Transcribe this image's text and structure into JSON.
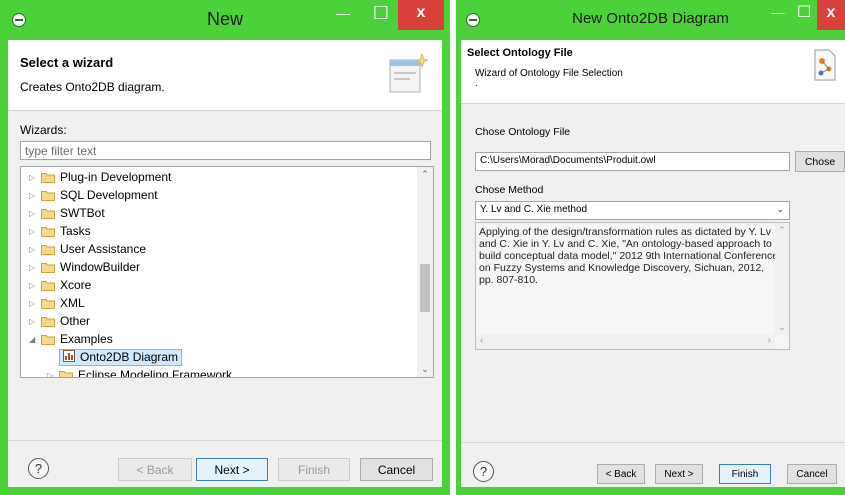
{
  "left_dialog": {
    "title": "New",
    "minimize": "—",
    "maximize": "☐",
    "close": "x",
    "header_title": "Select a wizard",
    "header_desc": "Creates Onto2DB diagram.",
    "wizards_label": "Wizards:",
    "filter_placeholder": "type filter text",
    "tree": [
      {
        "label": "Plug-in Development",
        "expanded": false
      },
      {
        "label": "SQL Development",
        "expanded": false
      },
      {
        "label": "SWTBot",
        "expanded": false
      },
      {
        "label": "Tasks",
        "expanded": false
      },
      {
        "label": "User Assistance",
        "expanded": false
      },
      {
        "label": "WindowBuilder",
        "expanded": false
      },
      {
        "label": "Xcore",
        "expanded": false
      },
      {
        "label": "XML",
        "expanded": false
      },
      {
        "label": "Other",
        "expanded": false
      },
      {
        "label": "Examples",
        "expanded": true
      },
      {
        "label": "Onto2DB Diagram",
        "selected": true
      },
      {
        "label": "Eclipse Modeling Framework",
        "expanded": false
      }
    ],
    "help": "?",
    "buttons": {
      "back": "< Back",
      "next": "Next >",
      "finish": "Finish",
      "cancel": "Cancel"
    }
  },
  "right_dialog": {
    "title": "New Onto2DB Diagram",
    "minimize": "—",
    "maximize": "☐",
    "close": "x",
    "header_title": "Select Ontology File",
    "header_desc": "Wizard of Ontology File Selection",
    "header_dot": ".",
    "file_label": "Chose Ontology File",
    "file_value": "C:\\Users\\Morad\\Documents\\Produit.owl",
    "browse_button": "Chose",
    "method_label": "Chose Method",
    "method_value": "Y. Lv and C. Xie method",
    "description": "Applying of the design/transformation rules as dictated by Y. Lv and C. Xie in Y. Lv and C. Xie, \"An ontology-based approach to build conceptual data model,\" 2012 9th International Conference on Fuzzy Systems and Knowledge Discovery, Sichuan, 2012, pp. 807-810.",
    "help": "?",
    "buttons": {
      "back": "< Back",
      "next": "Next >",
      "finish": "Finish",
      "cancel": "Cancel"
    }
  },
  "colors": {
    "window_frame": "#4cd13a",
    "close_button": "#d8413a",
    "selection": "#cde8ff"
  },
  "icons": {
    "window": "eclipse-icon",
    "folder": "folder-icon",
    "diagram": "diagram-icon",
    "wizard_banner": "wizard-banner-icon",
    "help": "help-icon"
  }
}
